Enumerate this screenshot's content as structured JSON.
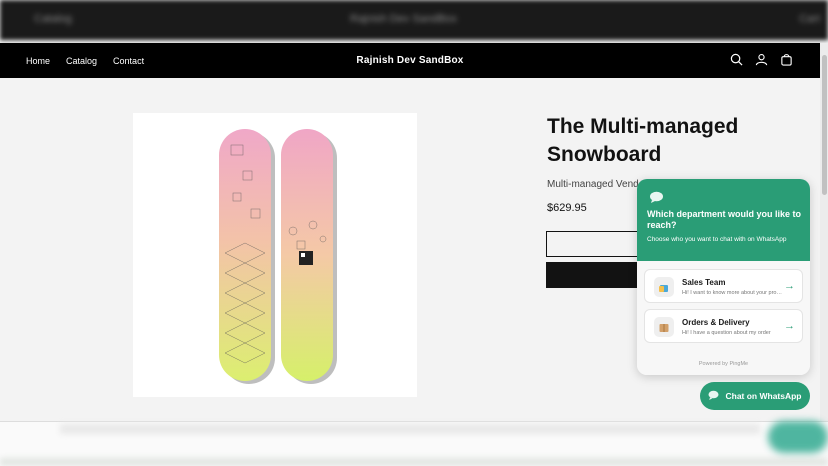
{
  "ghost": {
    "left": "Catalog",
    "center": "Rajnish Dev SandBox",
    "right": "Cart"
  },
  "header": {
    "nav": [
      "Home",
      "Catalog",
      "Contact"
    ],
    "store_name": "Rajnish Dev SandBox",
    "icons": [
      "search-icon",
      "account-icon",
      "cart-icon"
    ]
  },
  "product": {
    "title": "The Multi-managed Snowboard",
    "vendor": "Multi-managed Vendor",
    "price": "$629.95"
  },
  "whatsapp": {
    "question": "Which department would you like to reach?",
    "subtitle": "Choose who you want to chat with on WhatsApp",
    "departments": [
      {
        "name": "Sales Team",
        "message": "Hi! I want to know more about your products"
      },
      {
        "name": "Orders & Delivery",
        "message": "Hi! I have a question about my order"
      }
    ],
    "powered_by": "Powered by PingMe",
    "button_label": "Chat on WhatsApp",
    "accent": "#2a9d76"
  }
}
